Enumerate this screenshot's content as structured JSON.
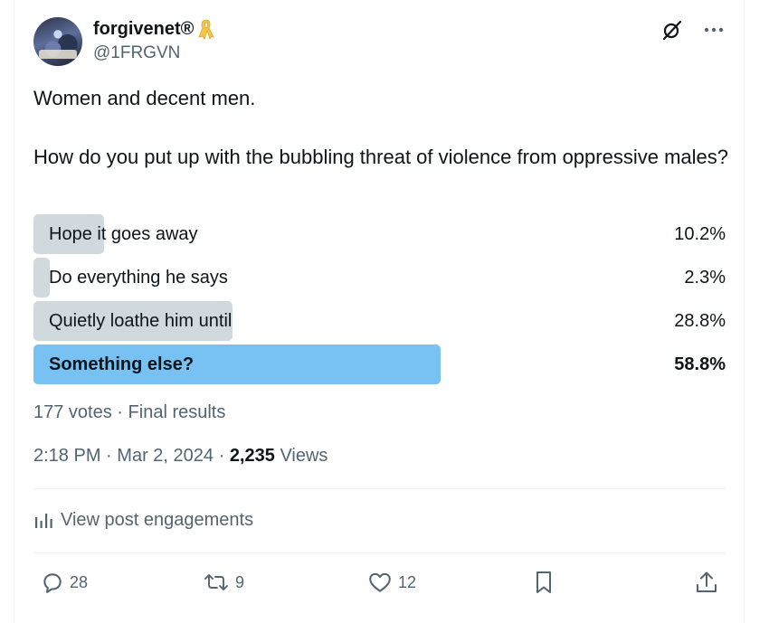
{
  "author": {
    "display_name": "forgivenet®",
    "handle": "@1FRGVN",
    "badge_icon": "yellow-ribbon-icon"
  },
  "tweet": {
    "line1": "Women and decent men.",
    "line2": "How do you put up with the bubbling threat of violence from oppressive males?"
  },
  "poll": {
    "options": [
      {
        "label": "Hope it goes away",
        "percent_text": "10.2%",
        "fraction": 0.102
      },
      {
        "label": "Do everything he says",
        "percent_text": "2.3%",
        "fraction": 0.023
      },
      {
        "label": "Quietly loathe him until",
        "percent_text": "28.8%",
        "fraction": 0.288
      },
      {
        "label": "Something else?",
        "percent_text": "58.8%",
        "fraction": 0.588
      }
    ],
    "winner_index": 3,
    "votes_text": "177 votes",
    "separator": "·",
    "status_text": "Final results"
  },
  "meta": {
    "time": "2:18 PM",
    "date": "Mar 2, 2024",
    "views_count": "2,235",
    "views_label": "Views"
  },
  "engagements_link": "View post engagements",
  "actions": {
    "replies": "28",
    "reposts": "9",
    "likes": "12"
  },
  "colors": {
    "winner_bar": "#78c1f3",
    "bar": "#cfd9de",
    "muted_text": "#536471",
    "text": "#0f1419"
  }
}
